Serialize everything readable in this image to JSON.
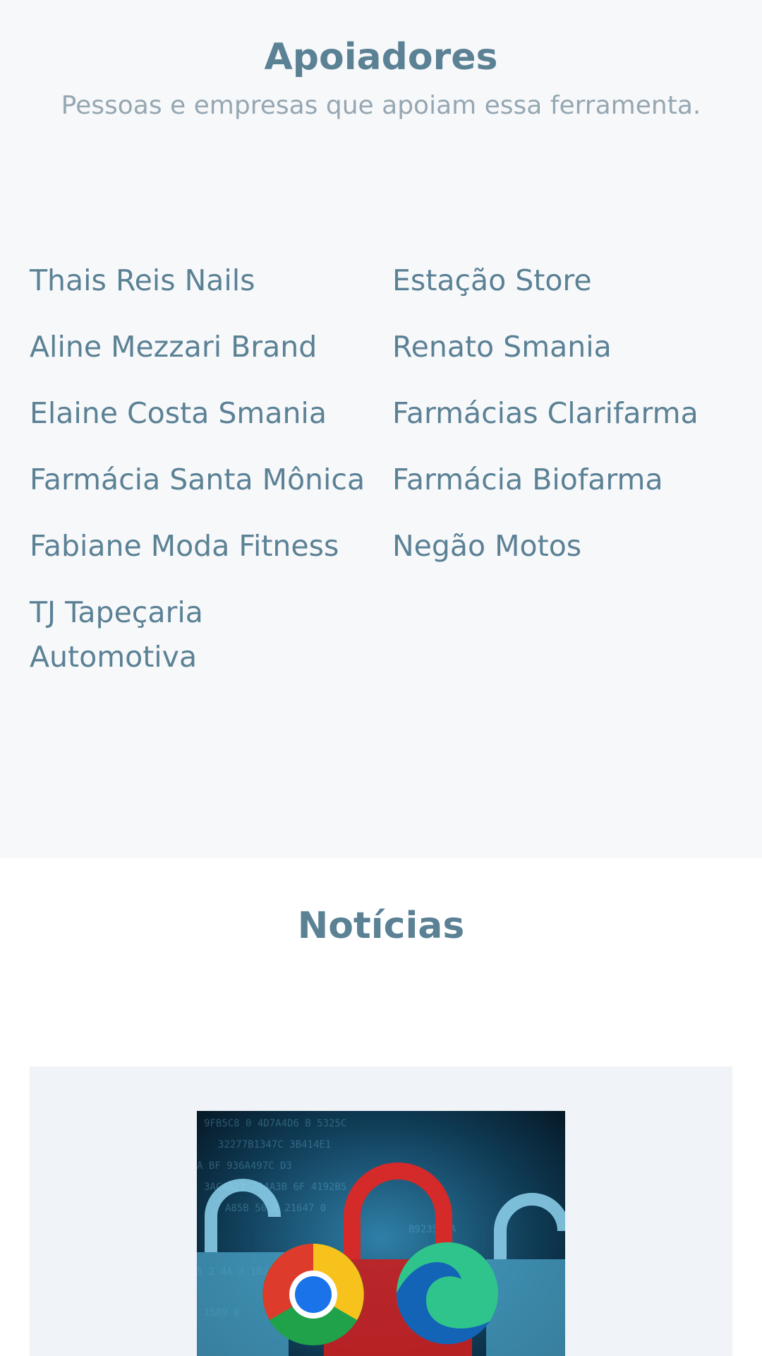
{
  "supporters": {
    "title": "Apoiadores",
    "subtitle": "Pessoas e empresas que apoiam essa ferramenta.",
    "items": [
      "Thais Reis Nails",
      "Estação Store",
      "Aline Mezzari Brand",
      "Renato Smania",
      "Elaine Costa Smania",
      "Farmácias Clarifarma",
      "Farmácia Santa Mônica",
      "Farmácia Biofarma",
      "Fabiane Moda Fitness",
      "Negão Motos",
      "TJ Tapeçaria Automotiva"
    ]
  },
  "news": {
    "title": "Notícias"
  },
  "colors": {
    "heading": "#5b8195",
    "subtitle": "#95a7b2",
    "section_bg": "#f7f8fa",
    "card_bg": "#f0f3f8"
  }
}
